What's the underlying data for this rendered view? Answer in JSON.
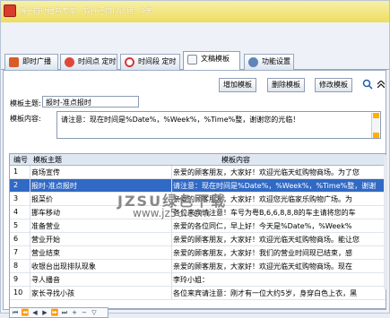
{
  "window": {
    "title": "博士自动播音专家，软件还可以试用：9天"
  },
  "tabs": [
    {
      "label": "即时广播",
      "icon": "broadcast-icon",
      "color": "#d95b28"
    },
    {
      "label": "时间点 定时",
      "icon": "alarm-clock-icon",
      "color": "#e0473b"
    },
    {
      "label": "时间段 定时",
      "icon": "clock-icon",
      "color": "#d33a38"
    },
    {
      "label": "文稿模板",
      "icon": "document-icon",
      "color": "#7f8a96"
    },
    {
      "label": "功能设置",
      "icon": "gear-icon",
      "color": "#5f86b9"
    }
  ],
  "toolbar": {
    "add": "增加模板",
    "delete": "删除模板",
    "modify": "修改模板"
  },
  "form": {
    "subject_label": "模板主题:",
    "subject_value": "报时-准点报时",
    "content_label": "模板内容:",
    "content_value": "请注意：现在时间是%Date%，%Week%，%Time%整，谢谢您的光临！"
  },
  "table": {
    "headers": [
      "编号",
      "模板主题",
      "模板内容"
    ],
    "rows": [
      [
        "1",
        "商场宣传",
        "亲爱的顾客朋友，大家好！欢迎光临天虹购物商场。为了您"
      ],
      [
        "2",
        "报时-准点报时",
        "请注意：现在时间是%Date%，%Week%，%Time%整，谢谢"
      ],
      [
        "3",
        "报菜价",
        "亲爱的顾客朋友，大家好！欢迎您光临家乐购物广场。为"
      ],
      [
        "4",
        "挪车移动",
        "各位来宾请注意！车号为粤B,6,6,8,8,8的车主请将您的车"
      ],
      [
        "5",
        "准备营业",
        "亲爱的各位同仁，早上好！今天是%Date%，%Week%"
      ],
      [
        "6",
        "营业开始",
        "亲爱的顾客朋友，大家好！欢迎光临天虹购物商场。能让您"
      ],
      [
        "7",
        "营业结束",
        "亲爱的顾客朋友，大家好！我们的营业时间现已结束，感"
      ],
      [
        "8",
        "收银台出现排队现象",
        "亲爱的顾客朋友，大家好！欢迎光临天虹购物商场。现在"
      ],
      [
        "9",
        "寻人播音",
        "李玲小姐："
      ],
      [
        "10",
        "家长寻找小孩",
        "各位来宾请注意：刚才有一位大约5岁，身穿白色上衣，黑"
      ]
    ],
    "selected_index": 1
  },
  "watermark": {
    "line1": "JZSU绿色下载",
    "line2": "www.jz5u.com"
  },
  "colors": {
    "selection": "#316ac5",
    "title_bar": "#eedd60"
  }
}
